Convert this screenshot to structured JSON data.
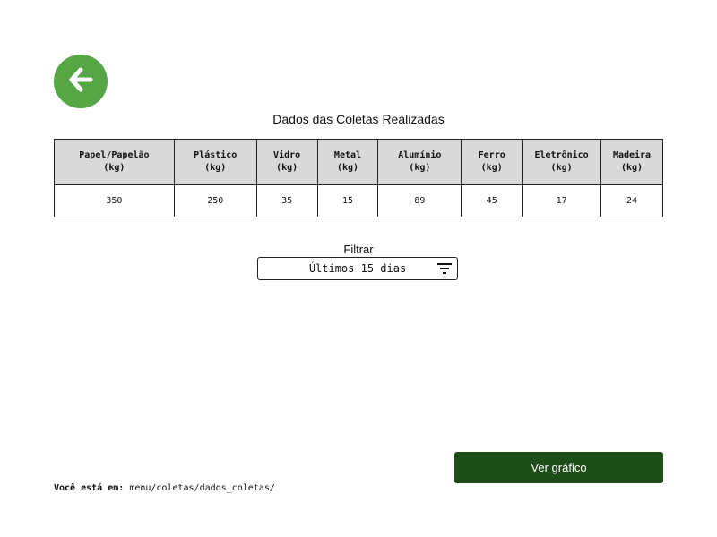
{
  "header": {
    "title": "Dados das Coletas Realizadas"
  },
  "table": {
    "columns": [
      {
        "name": "Papel/Papelão",
        "unit": "(kg)"
      },
      {
        "name": "Plástico",
        "unit": "(kg)"
      },
      {
        "name": "Vidro",
        "unit": "(kg)"
      },
      {
        "name": "Metal",
        "unit": "(kg)"
      },
      {
        "name": "Alumínio",
        "unit": "(kg)"
      },
      {
        "name": "Ferro",
        "unit": "(kg)"
      },
      {
        "name": "Eletrônico",
        "unit": "(kg)"
      },
      {
        "name": "Madeira",
        "unit": "(kg)"
      }
    ],
    "values": [
      "350",
      "250",
      "35",
      "15",
      "89",
      "45",
      "17",
      "24"
    ]
  },
  "filter": {
    "label": "Filtrar",
    "selected": "Últimos 15 dias"
  },
  "actions": {
    "graph_button": "Ver gráfico"
  },
  "breadcrumb": {
    "prefix": "Você está em:",
    "path": "menu/coletas/dados_coletas/"
  },
  "colors": {
    "back_button": "#56a646",
    "primary_button": "#1e4d1a",
    "table_header": "#d9d9d9"
  },
  "icons": {
    "back": "arrow-left-icon",
    "filter": "filter-lines-icon"
  }
}
